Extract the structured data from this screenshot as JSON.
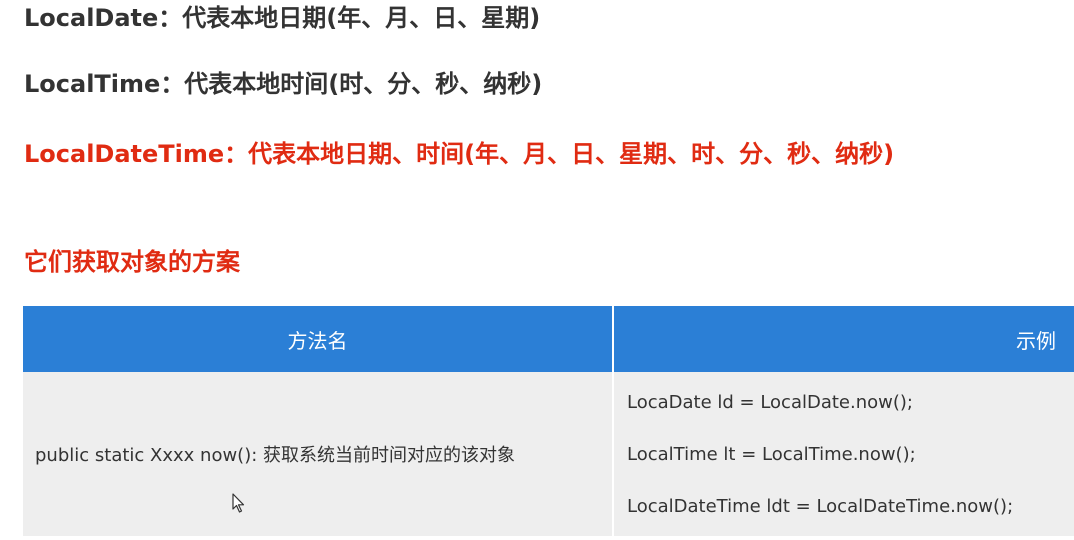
{
  "lines": [
    "LocalDate：代表本地日期(年、月、日、星期)",
    "LocalTime：代表本地时间(时、分、秒、纳秒)",
    "LocalDateTime：代表本地日期、时间(年、月、日、星期、时、分、秒、纳秒)"
  ],
  "section_title": "它们获取对象的方案",
  "table": {
    "headers": [
      "方法名",
      "示例"
    ],
    "row": {
      "method": "public static Xxxx now(): 获取系统当前时间对应的该对象",
      "examples": [
        "LocaDate ld = LocalDate.now();",
        "LocalTime lt = LocalTime.now();",
        "LocalDateTime ldt = LocalDateTime.now();"
      ]
    }
  },
  "colors": {
    "text": "#333333",
    "highlight": "#e02b12",
    "header_bg": "#2b7fd6",
    "row_bg": "#eeeeee"
  },
  "icons": [
    "mouse-cursor-icon"
  ]
}
